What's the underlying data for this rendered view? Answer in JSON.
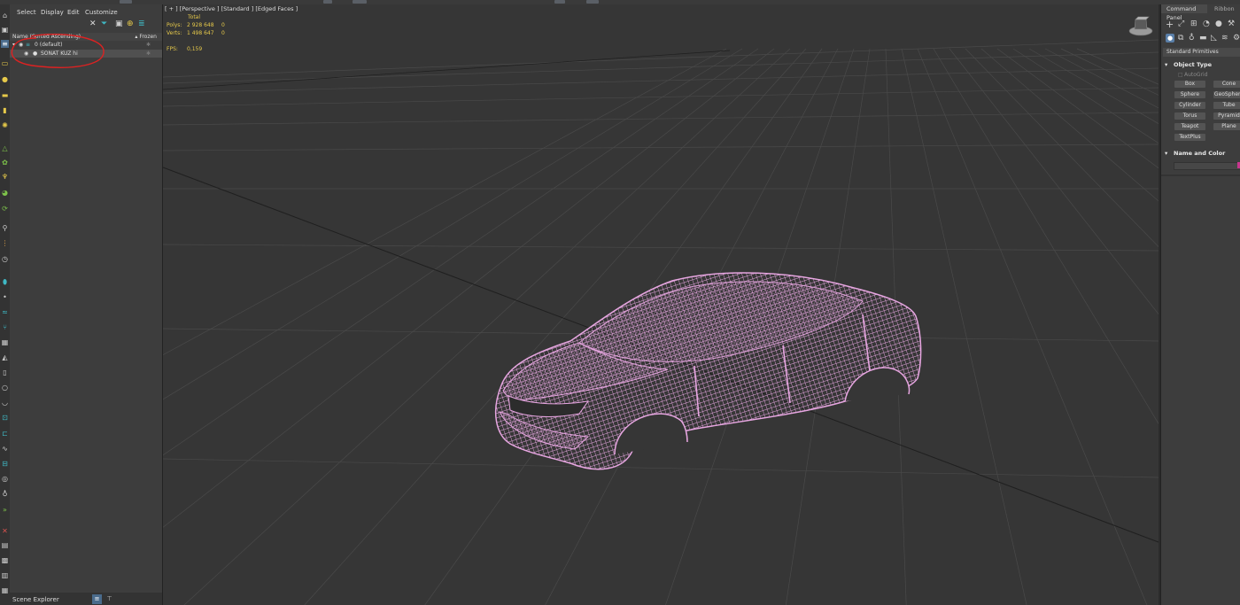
{
  "scene_explorer": {
    "menu": [
      "Select",
      "Display",
      "Edit",
      "Customize"
    ],
    "columns": {
      "name": "Name (Sorted Ascending)",
      "frozen": "▴ Frozen"
    },
    "tree": [
      {
        "label": "0 (default)"
      },
      {
        "label": "SONAT KUZ hi"
      }
    ],
    "footer_label": "Scene Explorer"
  },
  "viewport": {
    "label": "[ + ] [Perspective ] [Standard ] [Edged Faces ]",
    "stats": {
      "header": "Total",
      "polys_label": "Polys:",
      "polys_total": "2 928 648",
      "polys_sel": "0",
      "verts_label": "Verts:",
      "verts_total": "1 498 647",
      "verts_sel": "0",
      "fps_label": "FPS:",
      "fps_value": "0,159"
    },
    "colors": {
      "background": "#363636",
      "grid": "#4a4a4a",
      "wireframe": "#e7a6e1"
    }
  },
  "command_panel": {
    "tabs": [
      "Command Panel",
      "Ribbon"
    ],
    "category": "Standard Primitives",
    "object_type_title": "Object Type",
    "autogrid_label": "AutoGrid",
    "primitives": [
      "Box",
      "Cone",
      "Sphere",
      "GeoSphere",
      "Cylinder",
      "Tube",
      "Torus",
      "Pyramid",
      "Teapot",
      "Plane",
      "TextPlus"
    ],
    "name_color_title": "Name and Color",
    "accent_color": "#5a7fa8"
  }
}
